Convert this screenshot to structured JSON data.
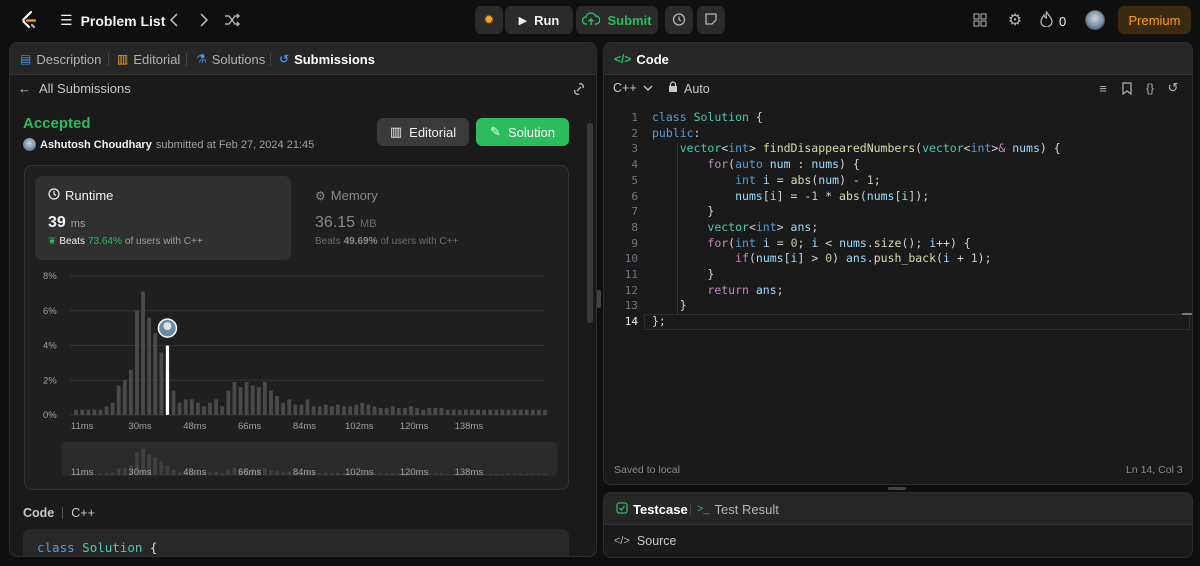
{
  "topbar": {
    "problem_list": "Problem List",
    "run": "Run",
    "submit": "Submit",
    "streak_count": "0",
    "premium": "Premium",
    "icons": [
      "logo-icon",
      "list-icon",
      "chevron-left-icon",
      "chevron-right-icon",
      "shuffle-icon",
      "debug-icon",
      "play-icon",
      "upload-cloud-icon",
      "alarm-icon",
      "note-icon",
      "grid-icon",
      "gear-icon",
      "fire-icon",
      "avatar"
    ]
  },
  "left": {
    "tabs": [
      "Description",
      "Editorial",
      "Solutions",
      "Submissions"
    ],
    "back_label": "All Submissions",
    "status": "Accepted",
    "author": "Ashutosh Choudhary",
    "submitted_text": "submitted at Feb 27, 2024 21:45",
    "editorial_btn": "Editorial",
    "solution_btn": "Solution",
    "runtime": {
      "title": "Runtime",
      "value": "39",
      "unit": "ms",
      "beats_label": "Beats",
      "beats_pct": "73.64%",
      "beats_suffix": "of users with C++"
    },
    "memory": {
      "title": "Memory",
      "value": "36.15",
      "unit": "MB",
      "beats_label": "Beats",
      "beats_pct": "49.69%",
      "beats_suffix": "of users with C++"
    },
    "code_label": "Code",
    "code_lang": "C++",
    "code_preview": "class Solution {"
  },
  "chart_data": {
    "type": "bar",
    "y_ticks": [
      "8%",
      "6%",
      "4%",
      "2%",
      "0%"
    ],
    "ylim": [
      0,
      8
    ],
    "x_ticks": [
      "11ms",
      "30ms",
      "48ms",
      "66ms",
      "84ms",
      "102ms",
      "120ms",
      "138ms"
    ],
    "xlim": [
      7,
      163
    ],
    "bin_ms": 2,
    "highlight_ms": 39,
    "values": [
      0.3,
      0.3,
      0.3,
      0.3,
      0.3,
      0.5,
      0.7,
      1.7,
      2.0,
      2.6,
      6.0,
      7.1,
      5.6,
      4.7,
      3.6,
      2.5,
      1.4,
      0.7,
      0.9,
      0.9,
      0.7,
      0.5,
      0.7,
      0.9,
      0.5,
      1.4,
      1.9,
      1.6,
      1.9,
      1.7,
      1.6,
      1.9,
      1.4,
      1.1,
      0.7,
      0.9,
      0.6,
      0.6,
      0.9,
      0.5,
      0.5,
      0.6,
      0.5,
      0.6,
      0.5,
      0.5,
      0.6,
      0.7,
      0.6,
      0.5,
      0.4,
      0.4,
      0.5,
      0.4,
      0.4,
      0.5,
      0.4,
      0.3,
      0.4,
      0.4,
      0.4,
      0.3,
      0.3,
      0.3,
      0.3,
      0.3,
      0.3,
      0.3,
      0.3,
      0.3,
      0.3,
      0.3,
      0.3,
      0.3,
      0.3,
      0.3,
      0.3,
      0.3
    ]
  },
  "editor": {
    "title": "Code",
    "lang": "C++",
    "mode": "Auto",
    "line_numbers": [
      "1",
      "2",
      "3",
      "4",
      "5",
      "6",
      "7",
      "8",
      "9",
      "10",
      "11",
      "12",
      "13",
      "14"
    ],
    "saved": "Saved to local",
    "cursor": "Ln 14, Col 3"
  },
  "bottom": {
    "tab_testcase": "Testcase",
    "tab_result": "Test Result",
    "source": "Source"
  }
}
